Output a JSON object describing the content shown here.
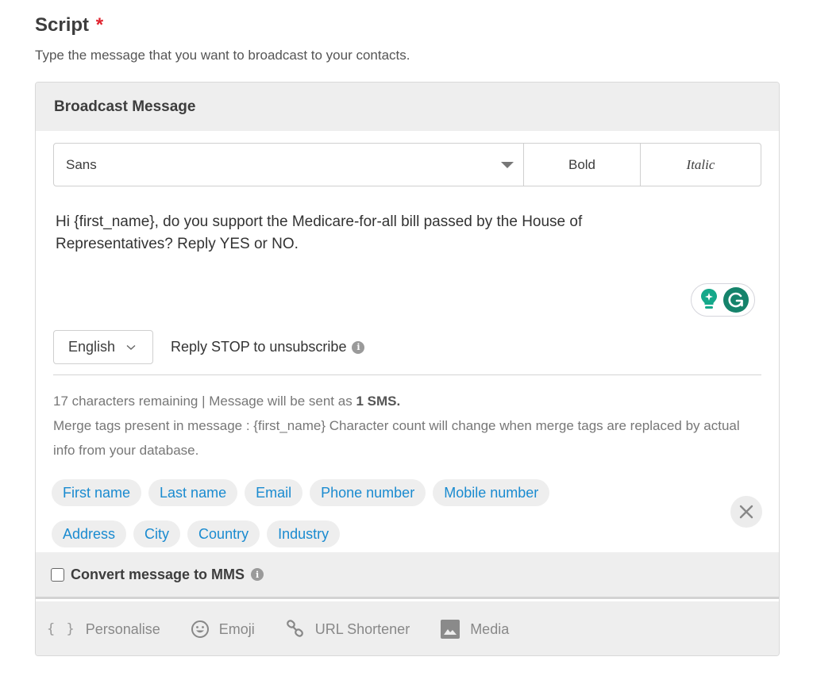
{
  "section": {
    "title": "Script",
    "required_marker": "*",
    "description": "Type the message that you want to broadcast to your contacts."
  },
  "card": {
    "title": "Broadcast Message",
    "toolbar": {
      "font_value": "Sans",
      "bold_label": "Bold",
      "italic_label": "Italic"
    },
    "message": "Hi {first_name}, do you support the Medicare-for-all bill passed by the House of Representatives? Reply YES or NO.",
    "language": "English",
    "optout_text": "Reply STOP to unsubscribe",
    "info_glyph": "i",
    "counts": {
      "remaining": "17 characters remaining | Message will be sent as ",
      "sms": "1 SMS.",
      "merge_note": "Merge tags present in message : {first_name} Character count will change when merge tags are replaced by actual info from your database."
    },
    "merge_tags": [
      "First name",
      "Last name",
      "Email",
      "Phone number",
      "Mobile number",
      "Address",
      "City",
      "Country",
      "Industry"
    ],
    "mms": {
      "label": "Convert message to MMS",
      "checked": false
    },
    "footer_tools": {
      "personalise": "Personalise",
      "personalise_glyph": "{ }",
      "emoji": "Emoji",
      "url_shortener": "URL Shortener",
      "media": "Media"
    }
  },
  "colors": {
    "required": "#e0232e",
    "tag_text": "#1a8bd0",
    "grammarly": "#15836b"
  }
}
